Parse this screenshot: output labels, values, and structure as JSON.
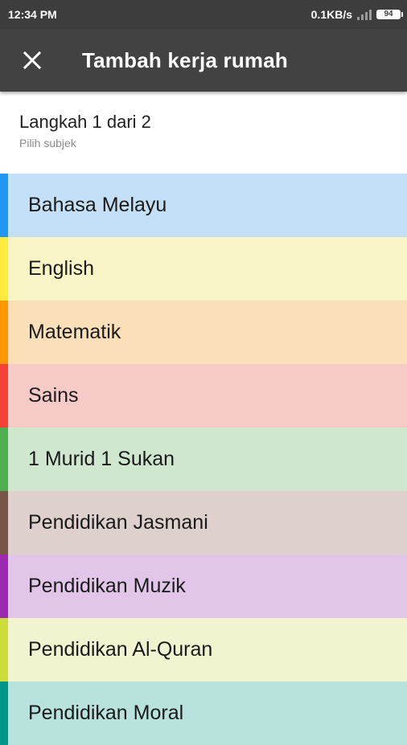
{
  "status_bar": {
    "time": "12:34 PM",
    "network_speed": "0.1KB/s",
    "network_type": "4G",
    "battery": "94"
  },
  "app_bar": {
    "title": "Tambah kerja rumah",
    "close_icon": "close-icon"
  },
  "step": {
    "title": "Langkah 1 dari 2",
    "subtitle": "Pilih subjek"
  },
  "subjects": [
    {
      "label": "Bahasa Melayu",
      "accent": "#2196f3",
      "background": "#c3e0f6"
    },
    {
      "label": "English",
      "accent": "#ffeb3b",
      "background": "#f9f4c5"
    },
    {
      "label": "Matematik",
      "accent": "#ff9800",
      "background": "#fbdfb8"
    },
    {
      "label": "Sains",
      "accent": "#f44336",
      "background": "#f6cbc7"
    },
    {
      "label": "1 Murid 1 Sukan",
      "accent": "#4caf50",
      "background": "#cfe7cf"
    },
    {
      "label": "Pendidikan Jasmani",
      "accent": "#795548",
      "background": "#ddd0cd"
    },
    {
      "label": "Pendidikan Muzik",
      "accent": "#9c27b0",
      "background": "#e2c6ea"
    },
    {
      "label": "Pendidikan Al-Quran",
      "accent": "#cddc39",
      "background": "#f1f4cf"
    },
    {
      "label": "Pendidikan Moral",
      "accent": "#009688",
      "background": "#b8e2dc"
    }
  ]
}
